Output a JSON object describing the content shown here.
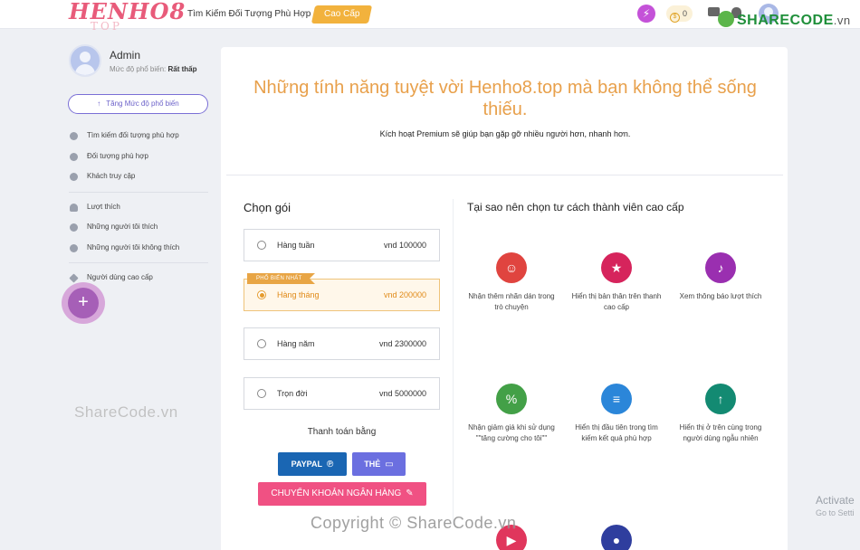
{
  "header": {
    "logo_text": "HENHO8",
    "logo_sub": "TOP",
    "nav_link": "Tìm Kiếm Đối Tượng Phù Hợp",
    "nav_premium": "Cao Cấp",
    "boost_glyph": "⚡",
    "credits": "0",
    "brand_name": "SHARECODE",
    "brand_suffix": ".vn"
  },
  "sidebar": {
    "name": "Admin",
    "level_label": "Mức độ phổ biến:",
    "level_value": "Rất thấp",
    "boost_button": "Tăng Mức độ phổ biến",
    "items_group1": [
      {
        "label": "Tìm kiếm đối tượng phù hợp",
        "icon": "search-icon"
      },
      {
        "label": "Đối tượng phù hợp",
        "icon": "target-icon"
      },
      {
        "label": "Khách truy cập",
        "icon": "eye-icon"
      }
    ],
    "items_group2": [
      {
        "label": "Lượt thích",
        "icon": "heart-icon"
      },
      {
        "label": "Những người tôi thích",
        "icon": "user-like-icon"
      },
      {
        "label": "Những người tôi không thích",
        "icon": "thumbs-down-icon"
      }
    ],
    "items_group3": [
      {
        "label": "Người dùng cao cấp",
        "icon": "star-icon"
      }
    ],
    "fab_glyph": "+"
  },
  "main": {
    "title": "Những tính năng tuyệt vời Henho8.top mà bạn không thể sống thiếu.",
    "subtitle": "Kích hoạt Premium sẽ giúp bạn gặp gỡ nhiều người hơn, nhanh hơn.",
    "choose_title": "Chọn gói",
    "popular_tag": "PHỔ BIẾN NHẤT",
    "plans": [
      {
        "name": "Hàng tuần",
        "price": "vnd 100000",
        "selected": false
      },
      {
        "name": "Hàng tháng",
        "price": "vnd 200000",
        "selected": true
      },
      {
        "name": "Hàng năm",
        "price": "vnd 2300000",
        "selected": false
      },
      {
        "name": "Trọn đời",
        "price": "vnd 5000000",
        "selected": false
      }
    ],
    "pay_title": "Thanh toán bằng",
    "pay_paypal": "PAYPAL",
    "pay_card": "THẺ",
    "pay_bank": "CHUYỂN KHOẢN NGÂN HÀNG",
    "why_title": "Tại sao nên chọn tư cách thành viên cao cấp",
    "features": [
      {
        "text": "Nhận thêm nhãn dán trong trò chuyện",
        "color": "#e0443f",
        "glyph": "☺",
        "icon": "sticker-icon"
      },
      {
        "text": "Hiển thị bản thân trên thanh cao cấp",
        "color": "#d6245c",
        "glyph": "★",
        "icon": "star-icon"
      },
      {
        "text": "Xem thông báo lượt thích",
        "color": "#9a2fb0",
        "glyph": "♪",
        "icon": "bell-icon"
      },
      {
        "text": "Nhận giảm giá khi sử dụng \"\"tăng cường cho tôi\"\"",
        "color": "#43a047",
        "glyph": "%",
        "icon": "discount-icon"
      },
      {
        "text": "Hiển thị đầu tiên trong tìm kiếm kết quả phù hợp",
        "color": "#2b86d9",
        "glyph": "≡",
        "icon": "layers-icon"
      },
      {
        "text": "Hiển thị ở trên cùng trong người dùng ngẫu nhiên",
        "color": "#138a72",
        "glyph": "↑",
        "icon": "upload-icon"
      },
      {
        "text": "",
        "color": "#e0365c",
        "glyph": "▶",
        "icon": "video-icon"
      },
      {
        "text": "",
        "color": "#2f3e9e",
        "glyph": "●",
        "icon": "location-icon"
      }
    ]
  },
  "watermarks": {
    "left": "ShareCode.vn",
    "bottom": "Copyright © ShareCode.vn"
  },
  "activate": {
    "title": "Activate",
    "sub": "Go to Setti"
  }
}
